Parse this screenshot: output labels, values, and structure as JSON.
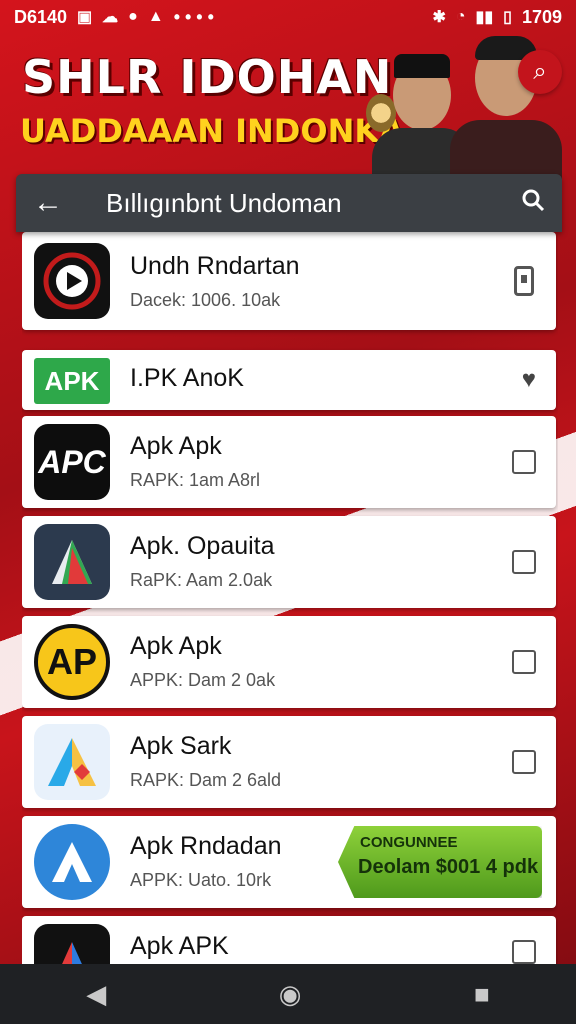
{
  "status_bar": {
    "left_text": "D6140",
    "left_icons": [
      "sim-icon",
      "chat-icon",
      "message-icon",
      "bag-icon"
    ],
    "dots": "• • • •",
    "time": "1709"
  },
  "banner": {
    "title": "SHLR IDOHAN",
    "subtitle": "UADDAAAN INDONKA"
  },
  "app_bar": {
    "back_glyph": "←",
    "title": "Bıllıgınbnt Undoman",
    "search_glyph": "🔍"
  },
  "list": [
    {
      "name": "Undh Rndartan",
      "meta": "Dacek: 1006. 10ak",
      "trailing": "phone"
    },
    {
      "name": "I.PK AnoK",
      "meta": "",
      "trailing": "heart",
      "tag": "APK"
    },
    {
      "name": "Apk  Apk",
      "meta": "RAPK: 1am A8rl",
      "trailing": "checkbox",
      "icon_text": "APC"
    },
    {
      "name": "Apk. Opauita",
      "meta": "RaPK: Aam 2.0ak",
      "trailing": "checkbox",
      "icon_text": ""
    },
    {
      "name": "Apk  Apk",
      "meta": "APPK: Dam 2 0ak",
      "trailing": "checkbox",
      "icon_text": "AP"
    },
    {
      "name": "Apk Sark",
      "meta": "RAPK: Dam 2 6ald",
      "trailing": "checkbox",
      "icon_text": ""
    },
    {
      "name": "Apk Rndadan",
      "meta": "APPK: Uato. 10rk",
      "trailing": "promo",
      "icon_text": ""
    },
    {
      "name": "Apk APK",
      "meta": "",
      "trailing": "checkbox",
      "icon_text": ""
    }
  ],
  "promo": {
    "line1": "CONGUNNEE",
    "line2": "Deolam $001 4 pdk"
  },
  "nav": {
    "back": "◀",
    "home": "◉",
    "recents": "■"
  },
  "colors": {
    "brand_red": "#c3141c",
    "appbar": "#3b3f44",
    "apk_green": "#2ea84a",
    "banner_yellow": "#ffd21e"
  }
}
